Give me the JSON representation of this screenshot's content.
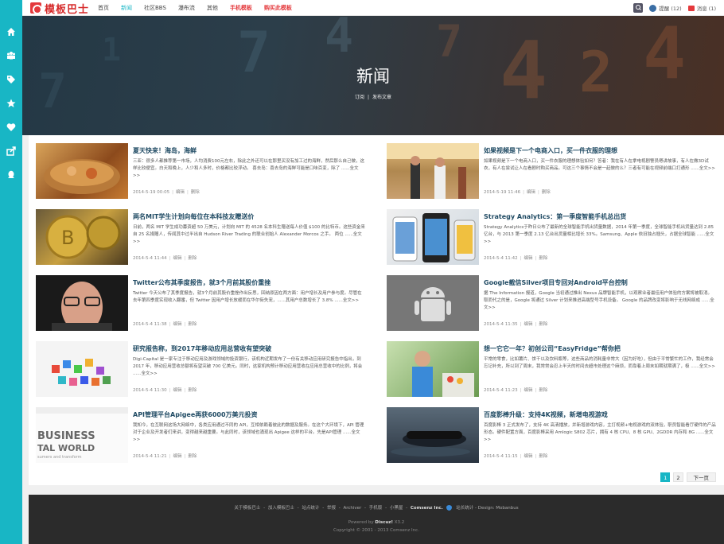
{
  "logo": {
    "text": "模板巴士"
  },
  "nav": [
    {
      "label": "首页",
      "style": "normal"
    },
    {
      "label": "新闻",
      "style": "active"
    },
    {
      "label": "社区BBS",
      "style": "normal"
    },
    {
      "label": "瀑布流",
      "style": "normal"
    },
    {
      "label": "其他",
      "style": "normal"
    },
    {
      "label": "手机模板",
      "style": "red"
    },
    {
      "label": "购买此模板",
      "style": "red"
    }
  ],
  "topbar": {
    "remind_label": "提醒 (12)",
    "message_label": "消息 (1)"
  },
  "banner": {
    "title": "新闻",
    "subscribe": "订阅",
    "divider": "|",
    "publish": "发布文章"
  },
  "articles": [
    {
      "title": "夏天快来！海岛，海鲜",
      "summary": "三亚：很多人都推荐第一市场，人均消费100元左右，除此之外还可以在那里买没有加工过的海鲜，然后那么自己做，这样比较便宜。白天和晚上，人少和人多时，价格都比较浮动。 喜去岛：喜去岛的海鲜可能是口味百变，除了 ......全文>>",
      "date": "2014-5-19 00:05",
      "edit": "编辑",
      "delete": "删除"
    },
    {
      "title": "如果视频是下一个电商入口，买一件衣服的理想",
      "summary": "如果视频是下一个电商入口，买一件衣服的理想体验如何？答者：我在有人在拿电视剧警员嗯讲故事，有人在做3D试衣，有人在尝试让人在看剧时购买商品。可这三个事情不会是一起做的么？三者有可能在视频前端口打通形 ......全文>>",
      "date": "2014-5-19 11:46",
      "edit": "编辑",
      "delete": "删除"
    },
    {
      "title": "两名MIT学生计划向每位在本科技友赠送价",
      "summary": "日前，两名 MIT 学生成功募资超 50 万美元，计划向 MIT 的 4528 名本科生赠送每人价值 $100 的比特币。这些资金来自 25 名捐赠人，传闻其中过半出自 Hudson River Trading 的联合创始人 Alexander Morcos 之手。 两位 ......全文>>",
      "date": "2014-5-4 11:44",
      "edit": "编辑",
      "delete": "删除"
    },
    {
      "title": "Strategy Analytics：第一季度智能手机总出货",
      "summary": "Strategy Analytics于昨日公布了最新的全球智能手机出货量数据，2014 年第一季度，全球智能手机出货量达到 2.85 亿台，与 2013 第一季度 2.13 亿台出货量相比增长 33%。Samsung、Apple 依旧独占翘头，占据全球智能 ......全文>>",
      "date": "2014-5-4 11:42",
      "edit": "编辑",
      "delete": "删除"
    },
    {
      "title": "Twitter公布其季度报告，就3个月前其股价重挫",
      "summary": "Twitter 今天公布了其季度报告，就3个月前其股价重挫作出反思，回纳原因在两方面：用户增长及用户参与度。尽管在去年第四季度实现收入翻番，但 Twitter 因用户增长放缓而在华尔街失宠，......其用户总数增长了 3.8% ......全文>>",
      "date": "2014-5-4 11:38",
      "edit": "编辑",
      "delete": "删除"
    },
    {
      "title": "Google截信Silver项目专回对Android平台控制",
      "summary": "据 The Information 报道，Google 当初通过推出 Nexus 品牌智能手机，以观察业者最佳用户体验的方案将被取消。取而代之的是，Google 将通过 Silver 计划来推进高端型号手机设备。 Google 的品牌改变将影响于无线网络成 ......全文>>",
      "date": "2014-5-4 11:35",
      "edit": "编辑",
      "delete": "删除"
    },
    {
      "title": "研究报告称，到2017年移动应用总营收有望突破",
      "summary": "Digi-Capital 是一家专注于移动应用及游戏领域的投资银行，该机构近期发布了一份有关移动应用研究报告中指出，到 2017 年，移动应用营收总额将有望突破 700 亿美元。同时，这家机构预计移动应用营收在应用总营收中的比例，将会 ......全文>>",
      "date": "2014-5-4 11:30",
      "edit": "编辑",
      "delete": "删除"
    },
    {
      "title": "想一它它一年？初创公司“EasyFridge”帮你把",
      "summary": "平常的零食，比如薯片、饼干以及饮料瓶等，这些商品的消耗量非常大（因为好吃），但由于平常繁忙的工作，我经常会忘记补充，所以到了周末，我常常会忍上半天的时间去超市处理这个麻烦，而靠着上周末如期就期满了，极 ......全文>>",
      "date": "2014-5-4 11:23",
      "edit": "编辑",
      "delete": "删除"
    },
    {
      "title": "API管理平台Apigee再获6000万美元投资",
      "summary": "我知今，在互联网这场大网络中，各类应用通过不同的 API，互相依赖着彼此的数据及服务。在这个大环境下，API 管理对于企业及开发者们来讲，变得越来越重要。与此同时，该领域也涌现出 Apigee 这样的平台。先是API管理 ......全文>>",
      "date": "2014-5-4 11:21",
      "edit": "编辑",
      "delete": "删除"
    },
    {
      "title": "百度影棒升级：支持4K视频，新增电视游戏",
      "summary": "百度影棒 3 正式发布了，支持 4K 高清播放，并新增游戏内容，主打视频+电视游戏的双体验，职员智能看厅硬件的产品形态。硬件配置方面，百度影棒采用 Amlogic S802 芯片，拥有 4 核 CPU、8 核 GPU、2GDDR 内存和 8G ......全文>>",
      "date": "2014-5-4 11:15",
      "edit": "编辑",
      "delete": "删除"
    }
  ],
  "pager": {
    "p1": "1",
    "p2": "2",
    "next": "下一页"
  },
  "footer": {
    "links": [
      "关于模板巴士",
      "-",
      "加入模板巴士",
      "-",
      "站点统计",
      "-",
      "举报",
      "-",
      "Archiver",
      "-",
      "手机版",
      "-",
      "小黑屋",
      "-"
    ],
    "company": "Comsenz Inc.",
    "extra": "站长统计 - Design: Mobanbus",
    "powered_prefix": "Powered by",
    "powered_name": "Discuz!",
    "powered_version": "X3.2",
    "copyright": "Copyright © 2001 - 2013 Comsenz Inc."
  },
  "colors": {
    "accent": "#18b6c5",
    "brand_red": "#e4393c",
    "title_blue": "#1f4a63",
    "footer_bg": "#2b2b2b"
  },
  "icons": {
    "sidebar": [
      "home-icon",
      "group-icon",
      "tag-icon",
      "star-icon",
      "heart-icon",
      "share-icon",
      "qq-icon"
    ],
    "topbar": [
      "search-icon",
      "avatar-icon",
      "message-icon"
    ]
  }
}
